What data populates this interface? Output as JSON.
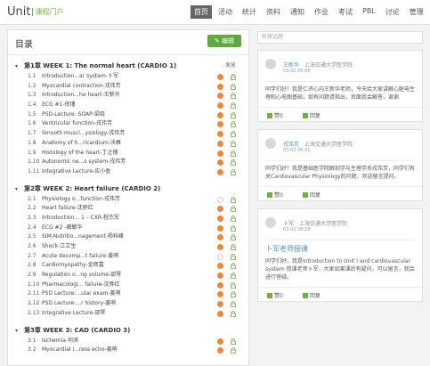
{
  "header": {
    "logo": "Unit",
    "logo_tag": "课程门户",
    "nav": [
      "首页",
      "活动",
      "统计",
      "资料",
      "通知",
      "作业",
      "考试",
      "PBL",
      "讨论",
      "管理"
    ],
    "active_nav": "首页"
  },
  "toc": {
    "title": "目录",
    "edit_label": "编辑",
    "publish_label": "发放",
    "chapters": [
      {
        "title": "第1章 WEEK 1: The normal heart (CARDIO 1)",
        "items": [
          {
            "num": "1.1",
            "label": "Introduction...ar system-卜军",
            "badge": "1"
          },
          {
            "num": "1.2",
            "label": "Myocardial contraction-戎伟芳",
            "badge": "1"
          },
          {
            "num": "1.3",
            "label": "Introduction...he heart-王新华",
            "badge": "1"
          },
          {
            "num": "1.4",
            "label": "ECG #1-徐瑾",
            "badge": "1"
          },
          {
            "num": "1.5",
            "label": "PSD-Lecture: SOAP-梁晓",
            "badge": "1"
          },
          {
            "num": "1.6",
            "label": "Ventricular function-戎伟芳",
            "badge": "1"
          },
          {
            "num": "1.7",
            "label": "Smooth muscl...ysiology-戎伟芳",
            "badge": "1"
          },
          {
            "num": "1.8",
            "label": "Anatomy of h...ricardium-沃雁",
            "badge": "1"
          },
          {
            "num": "1.9",
            "label": "Histology of the heart-丁之德",
            "badge": "1"
          },
          {
            "num": "1.10",
            "label": "Autonomic ne...s system-戎伟芳",
            "badge": "1"
          },
          {
            "num": "1.11",
            "label": "Integrative Lecture-应小盈",
            "badge": "1"
          }
        ]
      },
      {
        "title": "第2章 WEEK 2: Heart failure (CARDIO 2)",
        "items": [
          {
            "num": "2.1",
            "label": "Physiology o...function-戎伟芳",
            "badge": ""
          },
          {
            "num": "2.2",
            "label": "Heart failure-沈骅红",
            "badge": "1"
          },
          {
            "num": "2.3",
            "label": "Introduction... 1 – CXR-程杰军",
            "badge": "1"
          },
          {
            "num": "2.4",
            "label": "ECG #2 -臧敏华",
            "badge": "1"
          },
          {
            "num": "2.5",
            "label": "SIM-Nutritio...nagement-杨科峰",
            "badge": "1"
          },
          {
            "num": "2.6",
            "label": "Shock-江立生",
            "badge": "1"
          },
          {
            "num": "2.7",
            "label": "Acute decomp...t failure-姜哨",
            "badge": ""
          },
          {
            "num": "2.8",
            "label": "Cardiomyopathy-金辉富",
            "badge": "1"
          },
          {
            "num": "2.9",
            "label": "Regulation o...ng volume-邵琴",
            "badge": "1"
          },
          {
            "num": "2.10",
            "label": "Pharmacologi... failure-沈骅红",
            "badge": "1"
          },
          {
            "num": "2.11",
            "label": "PSD Lecture:...ular exam-姜哨",
            "badge": "1"
          },
          {
            "num": "2.12",
            "label": "PSD Lecture:...r history-姜哨",
            "badge": "1"
          },
          {
            "num": "2.13",
            "label": "Integrative Lecture-邵琴",
            "badge": "1"
          }
        ]
      },
      {
        "title": "第3章 WEEK 3: CAD (CARDIO 3)",
        "items": [
          {
            "num": "3.1",
            "label": "Ischemia-何滨",
            "badge": "1"
          },
          {
            "num": "3.2",
            "label": "Myocardial i...ress echo-姜哨",
            "badge": "1"
          }
        ]
      }
    ]
  },
  "discussion": {
    "search_placeholder": "新建话题",
    "like_label": "赞0",
    "reply_label": "回复",
    "posts": [
      {
        "name": "王新华",
        "school": "上海交通大学医学院",
        "date": "03-02 09:06",
        "title": "",
        "body": "同学们好！我是仁济心内王新华老师，今天给大家讲解心脏电生理和心电图基础，如有问题请指出，后面我会解答，谢谢"
      },
      {
        "name": "戎伟芳",
        "school": "上海交通大学医学院",
        "date": "03-02 08:31",
        "title": "",
        "body": "同学们好！我是基础医学院解剖学与生理学系戎伟芳，同学们有关Cardiovascular Physiology的问题，欢迎留言提问。"
      },
      {
        "name": "卜军",
        "school": "上海交通大学医学院",
        "date": "03-02 08:29",
        "title": "卜军老师授课",
        "body": "同学们好，我是Introduction to Unit I and cardiovascular system 授课老师卜军，大家如果课后有疑问，可以留言，我会进行答疑。"
      }
    ]
  }
}
